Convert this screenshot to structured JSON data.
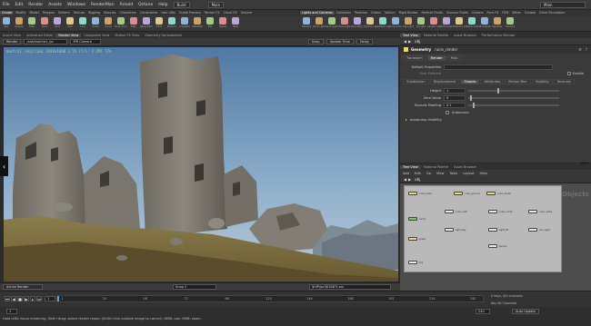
{
  "menubar": {
    "items": [
      "File",
      "Edit",
      "Render",
      "Assets",
      "Windows",
      "RenderMan",
      "Arnold",
      "Octane",
      "Help"
    ],
    "build_label": "Build",
    "desktop_label": "Main",
    "right_label": "Main"
  },
  "shelf_tabs": {
    "left": [
      "Create",
      "Modify",
      "Model",
      "Polygon",
      "Deform",
      "Texture",
      "Rigging",
      "Muscles",
      "Characters",
      "Constraints",
      "Hair Utils",
      "Guide Process",
      "Terrain FX",
      "Cloud FX",
      "Volume"
    ],
    "right": [
      "Lights and Cameras",
      "Collisions",
      "Particles",
      "Grains",
      "Vellum",
      "Rigid Bodies",
      "Particle Fluids",
      "Viscous Fluids",
      "Oceans",
      "Pyro FX",
      "FEM",
      "Wires",
      "Crowds",
      "Drive Simulation"
    ]
  },
  "shelf_tools": {
    "left": [
      "Box",
      "Sphere",
      "Tube",
      "Torus",
      "Grid",
      "Null",
      "Line",
      "Circle",
      "Curve",
      "Draw Curve",
      "Path",
      "Spray Paint",
      "Font",
      "Platonic",
      "L-System",
      "Metaball",
      "File",
      "Spiral",
      "Helix"
    ],
    "right": [
      "Camera",
      "Point Light",
      "Spot Light",
      "Area Light",
      "Geometry Light",
      "Volume Light",
      "Distant Light",
      "Environment Light",
      "Sky Light",
      "GI Light",
      "Caustic Light",
      "Portal Light",
      "Ambient Light",
      "Stereo Camera",
      "VR Camera",
      "Switcher",
      "Camera"
    ]
  },
  "left_panes": {
    "tabs": [
      "Scene View",
      "Animation Editor",
      "Render View",
      "Composite View",
      "Motion FX View",
      "Geometry Spreadsheet"
    ],
    "active_tab": "Render View"
  },
  "render_toolbar": {
    "render_button": "Render",
    "output_path": "/out/mantra1_ipr",
    "camera": "/obj/cam1",
    "frame_label": "IPR Camera",
    "update_time": "Update Time",
    "snapshot_label": "Snap",
    "delay_label": "Delay"
  },
  "viewport": {
    "overlay_text": "mantra1 /obj/cam1 1920x1080 3.55 (Tri: 4.2M) 57%"
  },
  "viewport_bottom": {
    "render_mode": "Active Render",
    "snapshot": "Snap 2",
    "path_text": "$HIP/ipr/$OS$F4.exr"
  },
  "right_panes": {
    "tabs": [
      "Tree View",
      "Material Palette",
      "Asset Browser",
      "Performance Monitor"
    ],
    "path": "obj",
    "node_type": "Geometry",
    "node_name": "ruins_render"
  },
  "params": {
    "top_tabs": [
      "Transform",
      "Render",
      "Misc"
    ],
    "active_top_tab": "Render",
    "default_properties_label": "Default Properties",
    "user_defined_label": "User Defined",
    "enable_label": "Enable",
    "sub_tabs": [
      "Subdivision",
      "Displacement",
      "Shapes",
      "Attributes",
      "Motion Blur",
      "Visibility",
      "Normals"
    ],
    "active_sub_tab": "Shapes",
    "fields": [
      {
        "label": "Height",
        "value": "1"
      },
      {
        "label": "Zero Value",
        "value": "0"
      },
      {
        "label": "Bounds Padding",
        "value": "0.1"
      }
    ],
    "autobump_label": "Autobump",
    "autobump_visibility_label": "Autobump Visibility"
  },
  "network": {
    "tabs": [
      "Tree View",
      "Material Palette",
      "Asset Browser"
    ],
    "menu": [
      "Add",
      "Edit",
      "Go",
      "View",
      "Tools",
      "Layout",
      "Help"
    ],
    "path": "obj",
    "overlay_word": "Objects",
    "nodes": [
      {
        "label": "ruins_main",
        "color": "#e8d87a"
      },
      {
        "label": "ruins_ground",
        "color": "#e8d87a"
      },
      {
        "label": "ruins_tower",
        "color": "#e8d87a"
      },
      {
        "label": "ruins_wall",
        "color": "#e8e8e8"
      },
      {
        "label": "ruins_rocks",
        "color": "#e8e8e8"
      },
      {
        "label": "ruins_walls",
        "color": "#e8e8e8"
      },
      {
        "label": "cam1",
        "color": "#7ac46a"
      },
      {
        "label": "light_key",
        "color": "#e8e8e8"
      },
      {
        "label": "light_fill",
        "color": "#e8e8e8"
      },
      {
        "label": "env_light",
        "color": "#e8e8e8"
      },
      {
        "label": "grass",
        "color": "#e8d87a"
      },
      {
        "label": "terrain",
        "color": "#e8e8e8"
      },
      {
        "label": "sky",
        "color": "#e8e8e8"
      }
    ]
  },
  "timeline": {
    "current_frame": "1",
    "start": "1",
    "end": "240",
    "ticks": [
      "1",
      "24",
      "48",
      "72",
      "96",
      "120",
      "144",
      "168",
      "192",
      "216",
      "240"
    ],
    "keys_label": "0 keys, 0/0 channels",
    "key_all_label": "Key All Channels",
    "auto_update": "Auto Update"
  },
  "status": {
    "message": "Hold LMB: focus rendering. Shift+drag: select render region (Shift+click outside image to cancel). MMB: pan. RMB: zoom."
  }
}
